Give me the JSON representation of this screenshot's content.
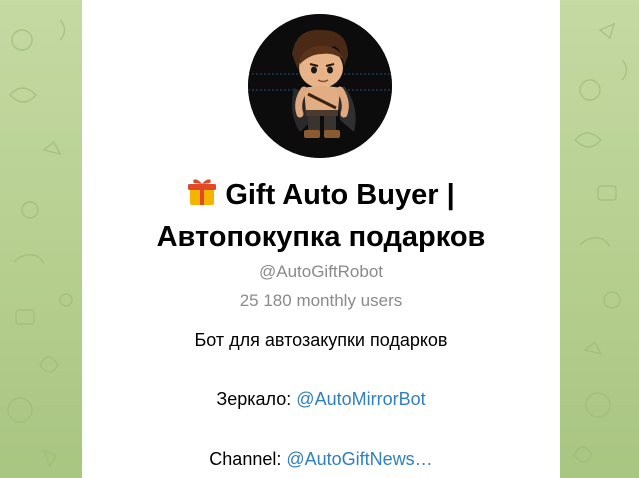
{
  "bot": {
    "title_icon": "gift-icon",
    "title": "Gift Auto Buyer | Автопокупка подарков",
    "username": "@AutoGiftRobot",
    "monthly_users": "25 180 monthly users",
    "description": "Бот для автозакупки подарков",
    "mirror_label": "Зеркало:",
    "mirror_link": "@AutoMirrorBot",
    "channel_label": "Channel:",
    "channel_link": "@AutoGiftNews…"
  },
  "colors": {
    "background": "#b6cf8f",
    "card": "#ffffff",
    "link": "#2f7fc1",
    "muted_text": "#8a8a8a",
    "avatar_bg": "#0c0c0c"
  }
}
